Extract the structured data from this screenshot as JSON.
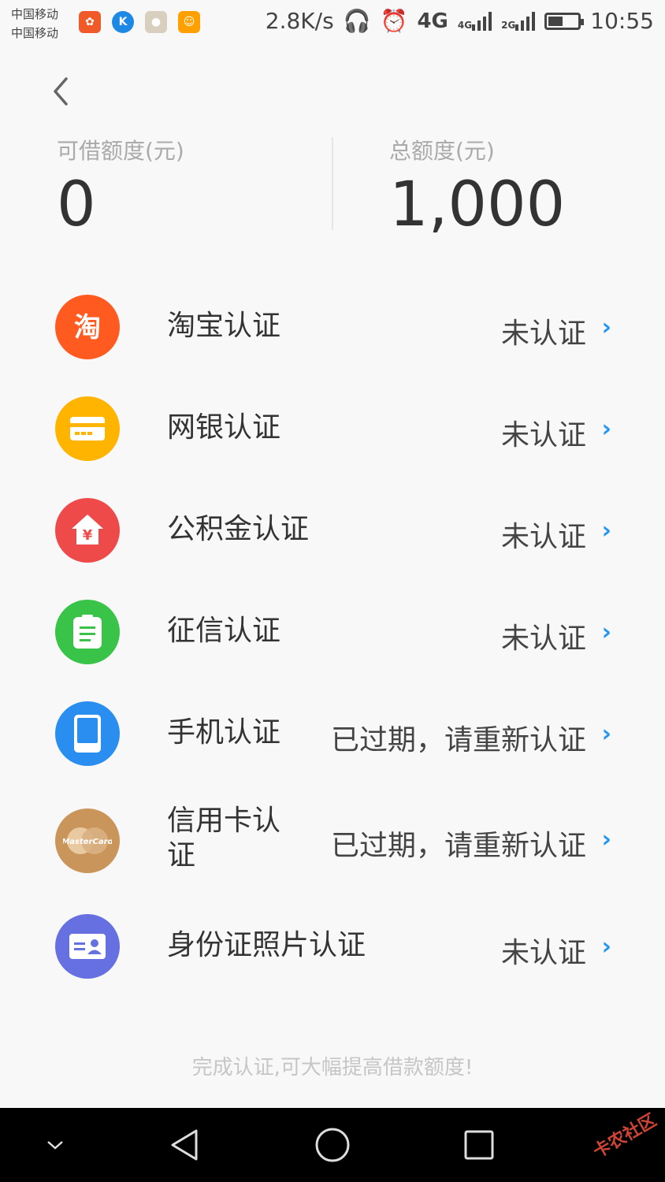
{
  "status_bar": {
    "carrier1": "中国移动",
    "carrier2": "中国移动",
    "speed": "2.8K/s",
    "net1": "4G",
    "net2": "4G",
    "net3": "2G",
    "time": "10:55"
  },
  "credit": {
    "available_label": "可借额度(元)",
    "available_value": "0",
    "total_label": "总额度(元)",
    "total_value": "1,000"
  },
  "items": [
    {
      "title": "淘宝认证",
      "status": "未认证",
      "icon": "taobao-icon",
      "color": "#ff5a1f"
    },
    {
      "title": "网银认证",
      "status": "未认证",
      "icon": "bankcard-icon",
      "color": "#ffb400"
    },
    {
      "title": "公积金认证",
      "status": "未认证",
      "icon": "house-fund-icon",
      "color": "#ef4a4a"
    },
    {
      "title": "征信认证",
      "status": "未认证",
      "icon": "credit-report-icon",
      "color": "#39c449"
    },
    {
      "title": "手机认证",
      "status": "已过期，请重新认证",
      "icon": "phone-icon",
      "color": "#2a8ef0"
    },
    {
      "title": "信用卡认\n证",
      "status": "已过期，请重新认证",
      "icon": "mastercard-icon",
      "color": "#c9955a"
    },
    {
      "title": "身份证照片认证",
      "status": "未认证",
      "icon": "id-card-icon",
      "color": "#6670e0"
    }
  ],
  "mastercard_text": "MasterCard",
  "footer_hint": "完成认证,可大幅提高借款额度!",
  "watermark": "卡农社区"
}
